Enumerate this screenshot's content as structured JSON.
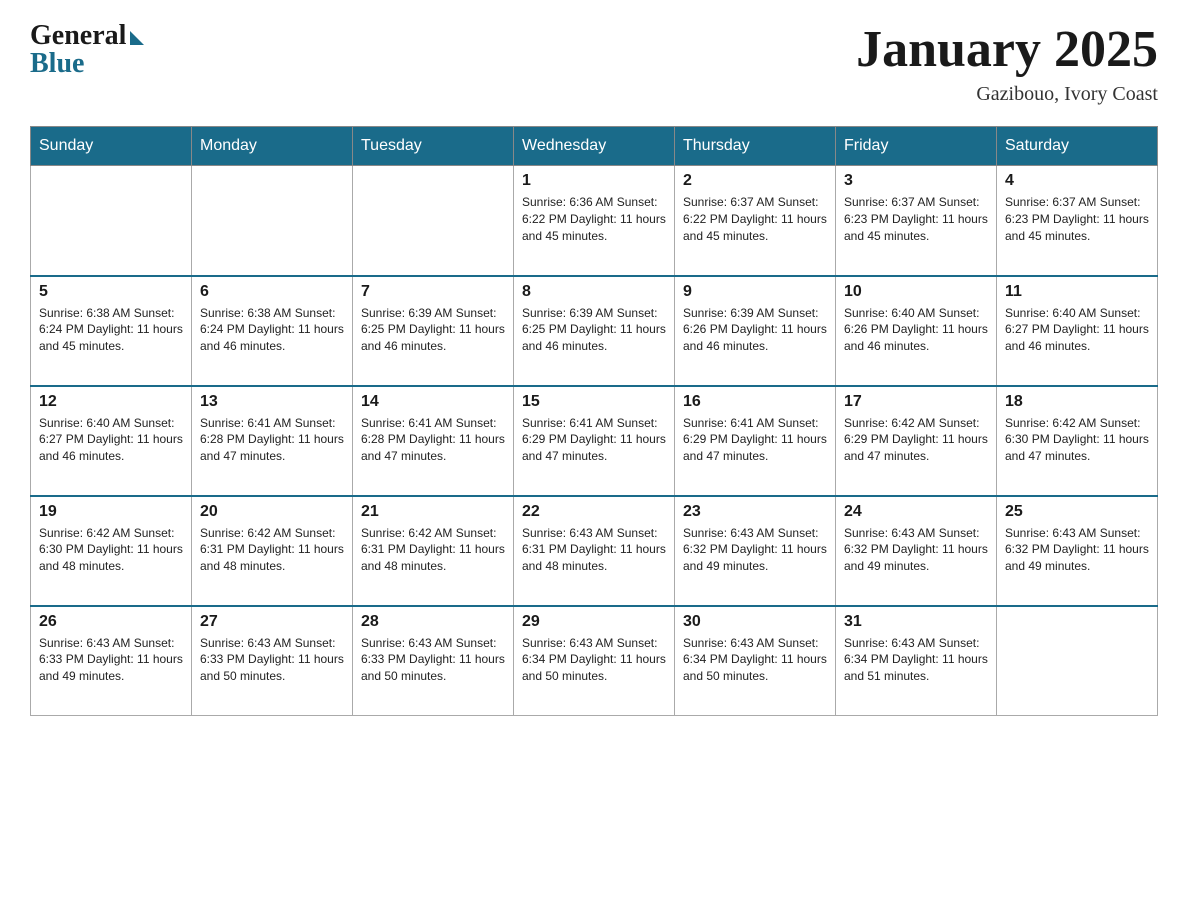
{
  "header": {
    "logo_general": "General",
    "logo_blue": "Blue",
    "month_title": "January 2025",
    "location": "Gazibouo, Ivory Coast"
  },
  "days_of_week": [
    "Sunday",
    "Monday",
    "Tuesday",
    "Wednesday",
    "Thursday",
    "Friday",
    "Saturday"
  ],
  "weeks": [
    {
      "cells": [
        {
          "day": "",
          "info": ""
        },
        {
          "day": "",
          "info": ""
        },
        {
          "day": "",
          "info": ""
        },
        {
          "day": "1",
          "info": "Sunrise: 6:36 AM\nSunset: 6:22 PM\nDaylight: 11 hours and 45 minutes."
        },
        {
          "day": "2",
          "info": "Sunrise: 6:37 AM\nSunset: 6:22 PM\nDaylight: 11 hours and 45 minutes."
        },
        {
          "day": "3",
          "info": "Sunrise: 6:37 AM\nSunset: 6:23 PM\nDaylight: 11 hours and 45 minutes."
        },
        {
          "day": "4",
          "info": "Sunrise: 6:37 AM\nSunset: 6:23 PM\nDaylight: 11 hours and 45 minutes."
        }
      ]
    },
    {
      "cells": [
        {
          "day": "5",
          "info": "Sunrise: 6:38 AM\nSunset: 6:24 PM\nDaylight: 11 hours and 45 minutes."
        },
        {
          "day": "6",
          "info": "Sunrise: 6:38 AM\nSunset: 6:24 PM\nDaylight: 11 hours and 46 minutes."
        },
        {
          "day": "7",
          "info": "Sunrise: 6:39 AM\nSunset: 6:25 PM\nDaylight: 11 hours and 46 minutes."
        },
        {
          "day": "8",
          "info": "Sunrise: 6:39 AM\nSunset: 6:25 PM\nDaylight: 11 hours and 46 minutes."
        },
        {
          "day": "9",
          "info": "Sunrise: 6:39 AM\nSunset: 6:26 PM\nDaylight: 11 hours and 46 minutes."
        },
        {
          "day": "10",
          "info": "Sunrise: 6:40 AM\nSunset: 6:26 PM\nDaylight: 11 hours and 46 minutes."
        },
        {
          "day": "11",
          "info": "Sunrise: 6:40 AM\nSunset: 6:27 PM\nDaylight: 11 hours and 46 minutes."
        }
      ]
    },
    {
      "cells": [
        {
          "day": "12",
          "info": "Sunrise: 6:40 AM\nSunset: 6:27 PM\nDaylight: 11 hours and 46 minutes."
        },
        {
          "day": "13",
          "info": "Sunrise: 6:41 AM\nSunset: 6:28 PM\nDaylight: 11 hours and 47 minutes."
        },
        {
          "day": "14",
          "info": "Sunrise: 6:41 AM\nSunset: 6:28 PM\nDaylight: 11 hours and 47 minutes."
        },
        {
          "day": "15",
          "info": "Sunrise: 6:41 AM\nSunset: 6:29 PM\nDaylight: 11 hours and 47 minutes."
        },
        {
          "day": "16",
          "info": "Sunrise: 6:41 AM\nSunset: 6:29 PM\nDaylight: 11 hours and 47 minutes."
        },
        {
          "day": "17",
          "info": "Sunrise: 6:42 AM\nSunset: 6:29 PM\nDaylight: 11 hours and 47 minutes."
        },
        {
          "day": "18",
          "info": "Sunrise: 6:42 AM\nSunset: 6:30 PM\nDaylight: 11 hours and 47 minutes."
        }
      ]
    },
    {
      "cells": [
        {
          "day": "19",
          "info": "Sunrise: 6:42 AM\nSunset: 6:30 PM\nDaylight: 11 hours and 48 minutes."
        },
        {
          "day": "20",
          "info": "Sunrise: 6:42 AM\nSunset: 6:31 PM\nDaylight: 11 hours and 48 minutes."
        },
        {
          "day": "21",
          "info": "Sunrise: 6:42 AM\nSunset: 6:31 PM\nDaylight: 11 hours and 48 minutes."
        },
        {
          "day": "22",
          "info": "Sunrise: 6:43 AM\nSunset: 6:31 PM\nDaylight: 11 hours and 48 minutes."
        },
        {
          "day": "23",
          "info": "Sunrise: 6:43 AM\nSunset: 6:32 PM\nDaylight: 11 hours and 49 minutes."
        },
        {
          "day": "24",
          "info": "Sunrise: 6:43 AM\nSunset: 6:32 PM\nDaylight: 11 hours and 49 minutes."
        },
        {
          "day": "25",
          "info": "Sunrise: 6:43 AM\nSunset: 6:32 PM\nDaylight: 11 hours and 49 minutes."
        }
      ]
    },
    {
      "cells": [
        {
          "day": "26",
          "info": "Sunrise: 6:43 AM\nSunset: 6:33 PM\nDaylight: 11 hours and 49 minutes."
        },
        {
          "day": "27",
          "info": "Sunrise: 6:43 AM\nSunset: 6:33 PM\nDaylight: 11 hours and 50 minutes."
        },
        {
          "day": "28",
          "info": "Sunrise: 6:43 AM\nSunset: 6:33 PM\nDaylight: 11 hours and 50 minutes."
        },
        {
          "day": "29",
          "info": "Sunrise: 6:43 AM\nSunset: 6:34 PM\nDaylight: 11 hours and 50 minutes."
        },
        {
          "day": "30",
          "info": "Sunrise: 6:43 AM\nSunset: 6:34 PM\nDaylight: 11 hours and 50 minutes."
        },
        {
          "day": "31",
          "info": "Sunrise: 6:43 AM\nSunset: 6:34 PM\nDaylight: 11 hours and 51 minutes."
        },
        {
          "day": "",
          "info": ""
        }
      ]
    }
  ]
}
